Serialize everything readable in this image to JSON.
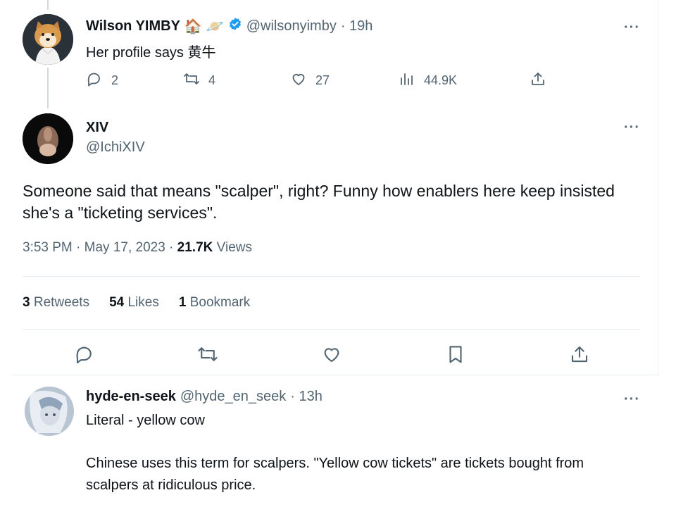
{
  "tweet1": {
    "name": "Wilson YIMBY",
    "handle": "@wilsonyimby",
    "time": "· 19h",
    "text": "Her profile says 黄牛",
    "emojis": [
      "🏠",
      "🪐"
    ],
    "actions": {
      "replies": "2",
      "retweets": "4",
      "likes": "27",
      "views": "44.9K"
    }
  },
  "tweet2": {
    "name": "XIV",
    "handle": "@IchiXIV",
    "text": "Someone said that means \"scalper\", right? Funny how enablers here keep insisted she's a \"ticketing services\".",
    "time": "3:53 PM · May 17, 2023 ·",
    "views_count": "21.7K",
    "views_label": "Views",
    "stats": {
      "retweets_count": "3",
      "retweets_label": "Retweets",
      "likes_count": "54",
      "likes_label": "Likes",
      "bookmarks_count": "1",
      "bookmarks_label": "Bookmark"
    }
  },
  "tweet3": {
    "name": "hyde-en-seek",
    "handle": "@hyde_en_seek",
    "time": "· 13h",
    "text1": "Literal - yellow cow",
    "text2": "Chinese uses this term for scalpers. \"Yellow cow tickets\" are tickets bought from scalpers at ridiculous price."
  },
  "more_label": "···",
  "colors": {
    "verified": "#1d9bf0",
    "muted": "#536471",
    "text": "#0f1419",
    "divider": "#e6ecf0"
  },
  "icons": [
    "reply-icon",
    "retweet-icon",
    "like-icon",
    "views-icon",
    "share-icon",
    "bookmark-icon",
    "verified-badge-icon"
  ]
}
